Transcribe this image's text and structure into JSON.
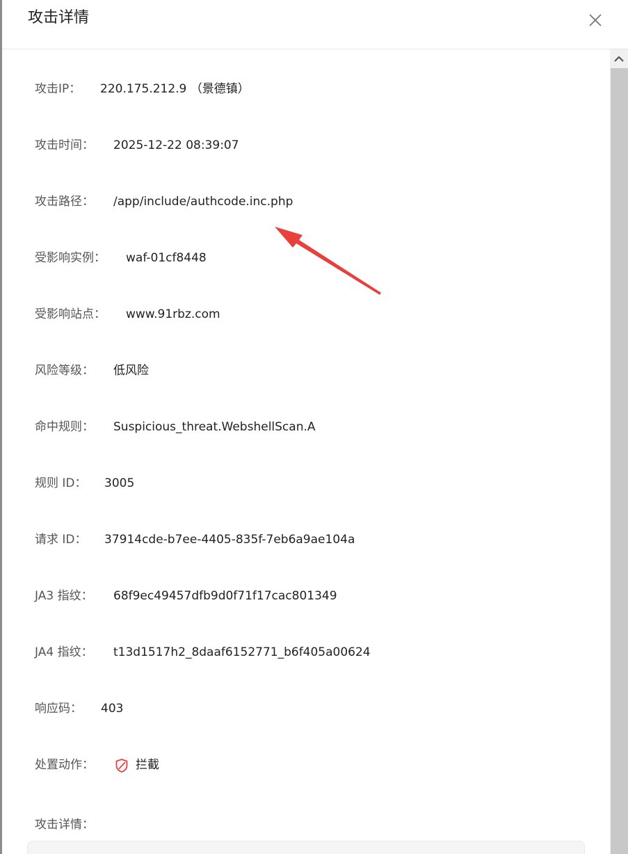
{
  "dialog": {
    "title": "攻击详情"
  },
  "fields": {
    "attack_ip": {
      "label": "攻击IP：",
      "value": "220.175.212.9 （景德镇）"
    },
    "attack_time": {
      "label": "攻击时间：",
      "value": "2025-12-22 08:39:07"
    },
    "attack_path": {
      "label": "攻击路径：",
      "value": "/app/include/authcode.inc.php"
    },
    "affected_instance": {
      "label": "受影响实例：",
      "value": "waf-01cf8448"
    },
    "affected_site": {
      "label": "受影响站点：",
      "value": "www.91rbz.com"
    },
    "risk_level": {
      "label": "风险等级：",
      "value": "低风险"
    },
    "hit_rule": {
      "label": "命中规则：",
      "value": "Suspicious_threat.WebshellScan.A"
    },
    "rule_id": {
      "label": "规则 ID：",
      "value": "3005"
    },
    "request_id": {
      "label": "请求 ID：",
      "value": "37914cde-b7ee-4405-835f-7eb6a9ae104a"
    },
    "ja3": {
      "label": "JA3 指纹：",
      "value": "68f9ec49457dfb9d0f71f17cac801349"
    },
    "ja4": {
      "label": "JA4 指纹：",
      "value": "t13d1517h2_8daaf6152771_b6f405a00624"
    },
    "response_code": {
      "label": "响应码：",
      "value": "403"
    },
    "action": {
      "label": "处置动作：",
      "value": "拦截",
      "icon": "shield-block-icon",
      "icon_color": "#e8413c"
    },
    "attack_details": {
      "label": "攻击详情："
    }
  },
  "annotation": {
    "color": "#e8413c",
    "icon": "red-arrow-icon"
  }
}
